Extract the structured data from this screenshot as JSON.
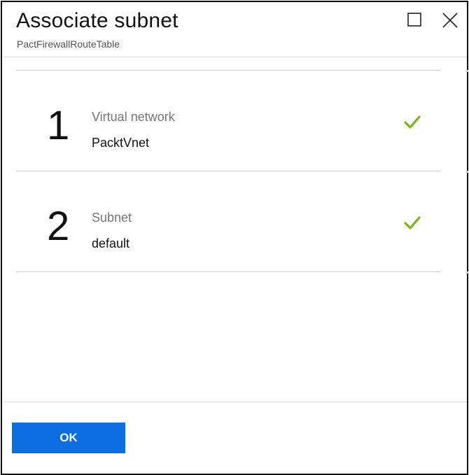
{
  "dialog": {
    "title": "Associate subnet",
    "subtitle": "PactFirewallRouteTable"
  },
  "window_controls": {
    "maximize_icon": "maximize-icon",
    "close_icon": "close-icon"
  },
  "steps": [
    {
      "number": "1",
      "label": "Virtual network",
      "value": "PacktVnet",
      "status": "complete"
    },
    {
      "number": "2",
      "label": "Subnet",
      "value": "default",
      "status": "complete"
    }
  ],
  "footer": {
    "ok_label": "OK"
  },
  "colors": {
    "accent": "#0a6ee0",
    "check": "#7ab51d"
  }
}
